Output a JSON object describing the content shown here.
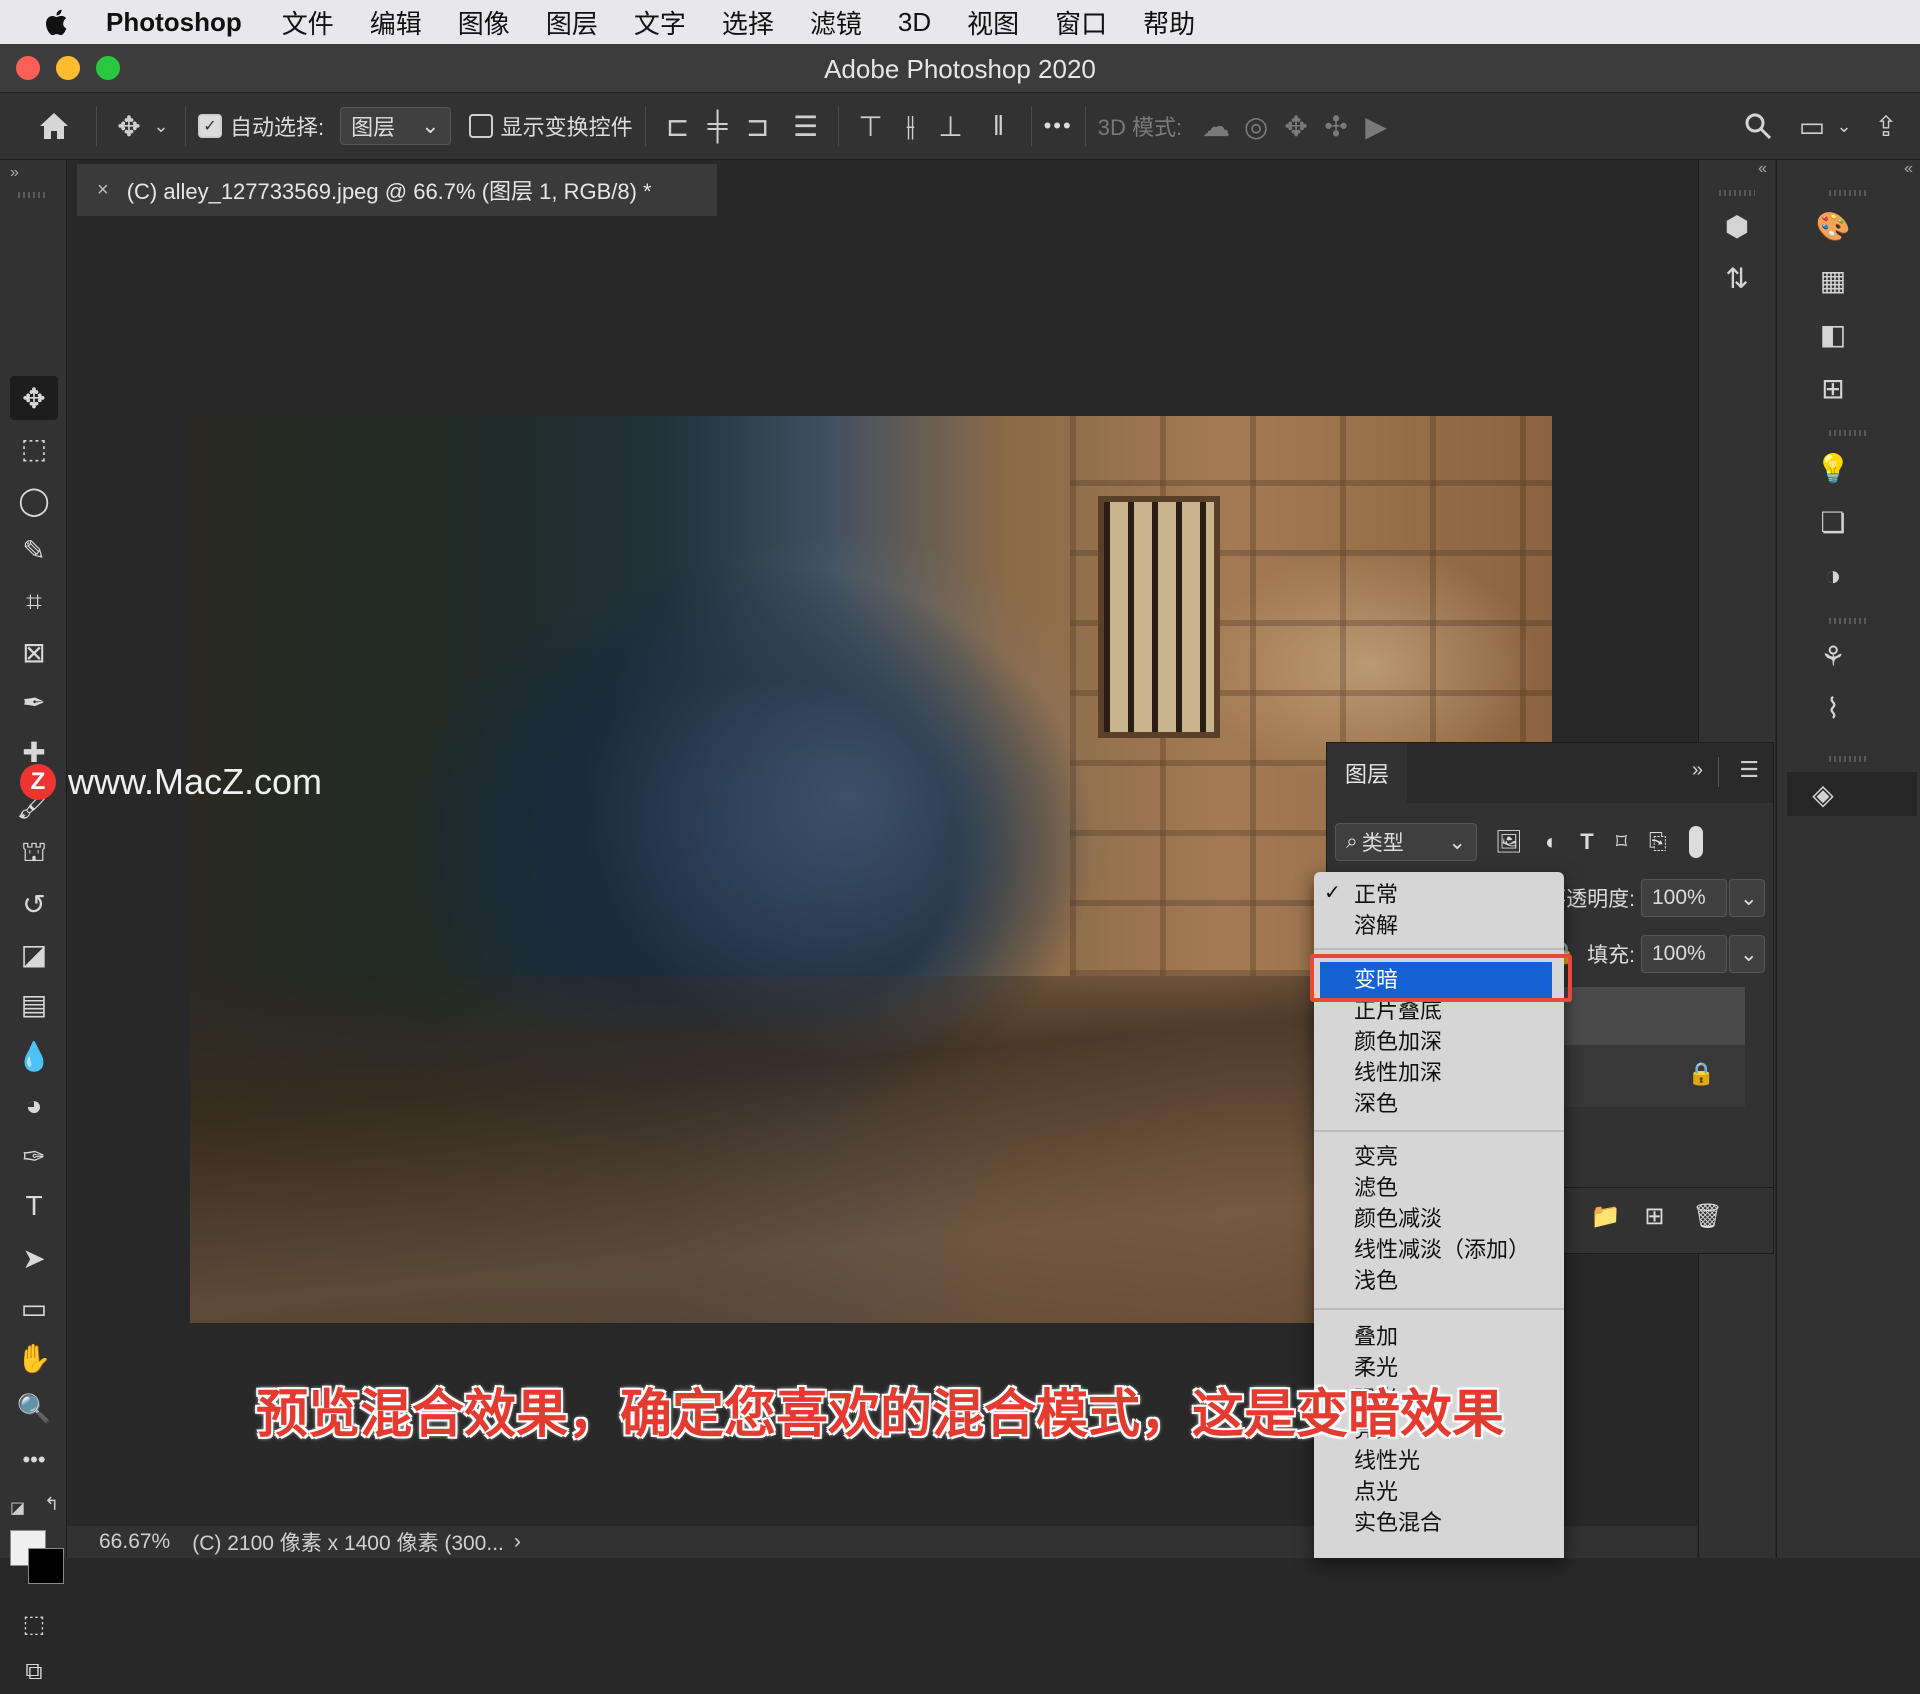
{
  "menubar": {
    "app_name": "Photoshop",
    "items": [
      "文件",
      "编辑",
      "图像",
      "图层",
      "文字",
      "选择",
      "滤镜",
      "3D",
      "视图",
      "窗口",
      "帮助"
    ]
  },
  "window": {
    "title": "Adobe Photoshop 2020"
  },
  "options_bar": {
    "auto_select_label": "自动选择:",
    "auto_select_value": "图层",
    "show_transform_label": "显示变换控件",
    "more": "•••",
    "mode_3d_label": "3D 模式:"
  },
  "document": {
    "tab_title": "(C) alley_127733569.jpeg @ 66.7% (图层 1, RGB/8) *",
    "zoom_status": "66.67%",
    "info_status": "(C) 2100 像素 x 1400 像素 (300...",
    "status_chevron": "›"
  },
  "watermark": {
    "logo_letter": "Z",
    "text": "www.MacZ.com"
  },
  "layers_panel": {
    "tab_label": "图层",
    "filter_label": "类型",
    "opacity_label": "不透明度:",
    "opacity_value": "100%",
    "fill_label": "填充:",
    "fill_value": "100%"
  },
  "blend_menu": {
    "selected": "正常",
    "highlighted": "变暗",
    "groups": [
      [
        "正常",
        "溶解"
      ],
      [
        "变暗",
        "正片叠底",
        "颜色加深",
        "线性加深",
        "深色"
      ],
      [
        "变亮",
        "滤色",
        "颜色减淡",
        "线性减淡（添加）",
        "浅色"
      ],
      [
        "叠加",
        "柔光",
        "强光",
        "亮光",
        "线性光",
        "点光",
        "实色混合"
      ]
    ]
  },
  "caption": "预览混合效果，确定您喜欢的混合模式，这是变暗效果",
  "colors": {
    "highlight": "#1462d4",
    "annotation_red": "#e8473c",
    "close": "#fe5f57",
    "minimize": "#febc2e",
    "zoom": "#28c840"
  }
}
